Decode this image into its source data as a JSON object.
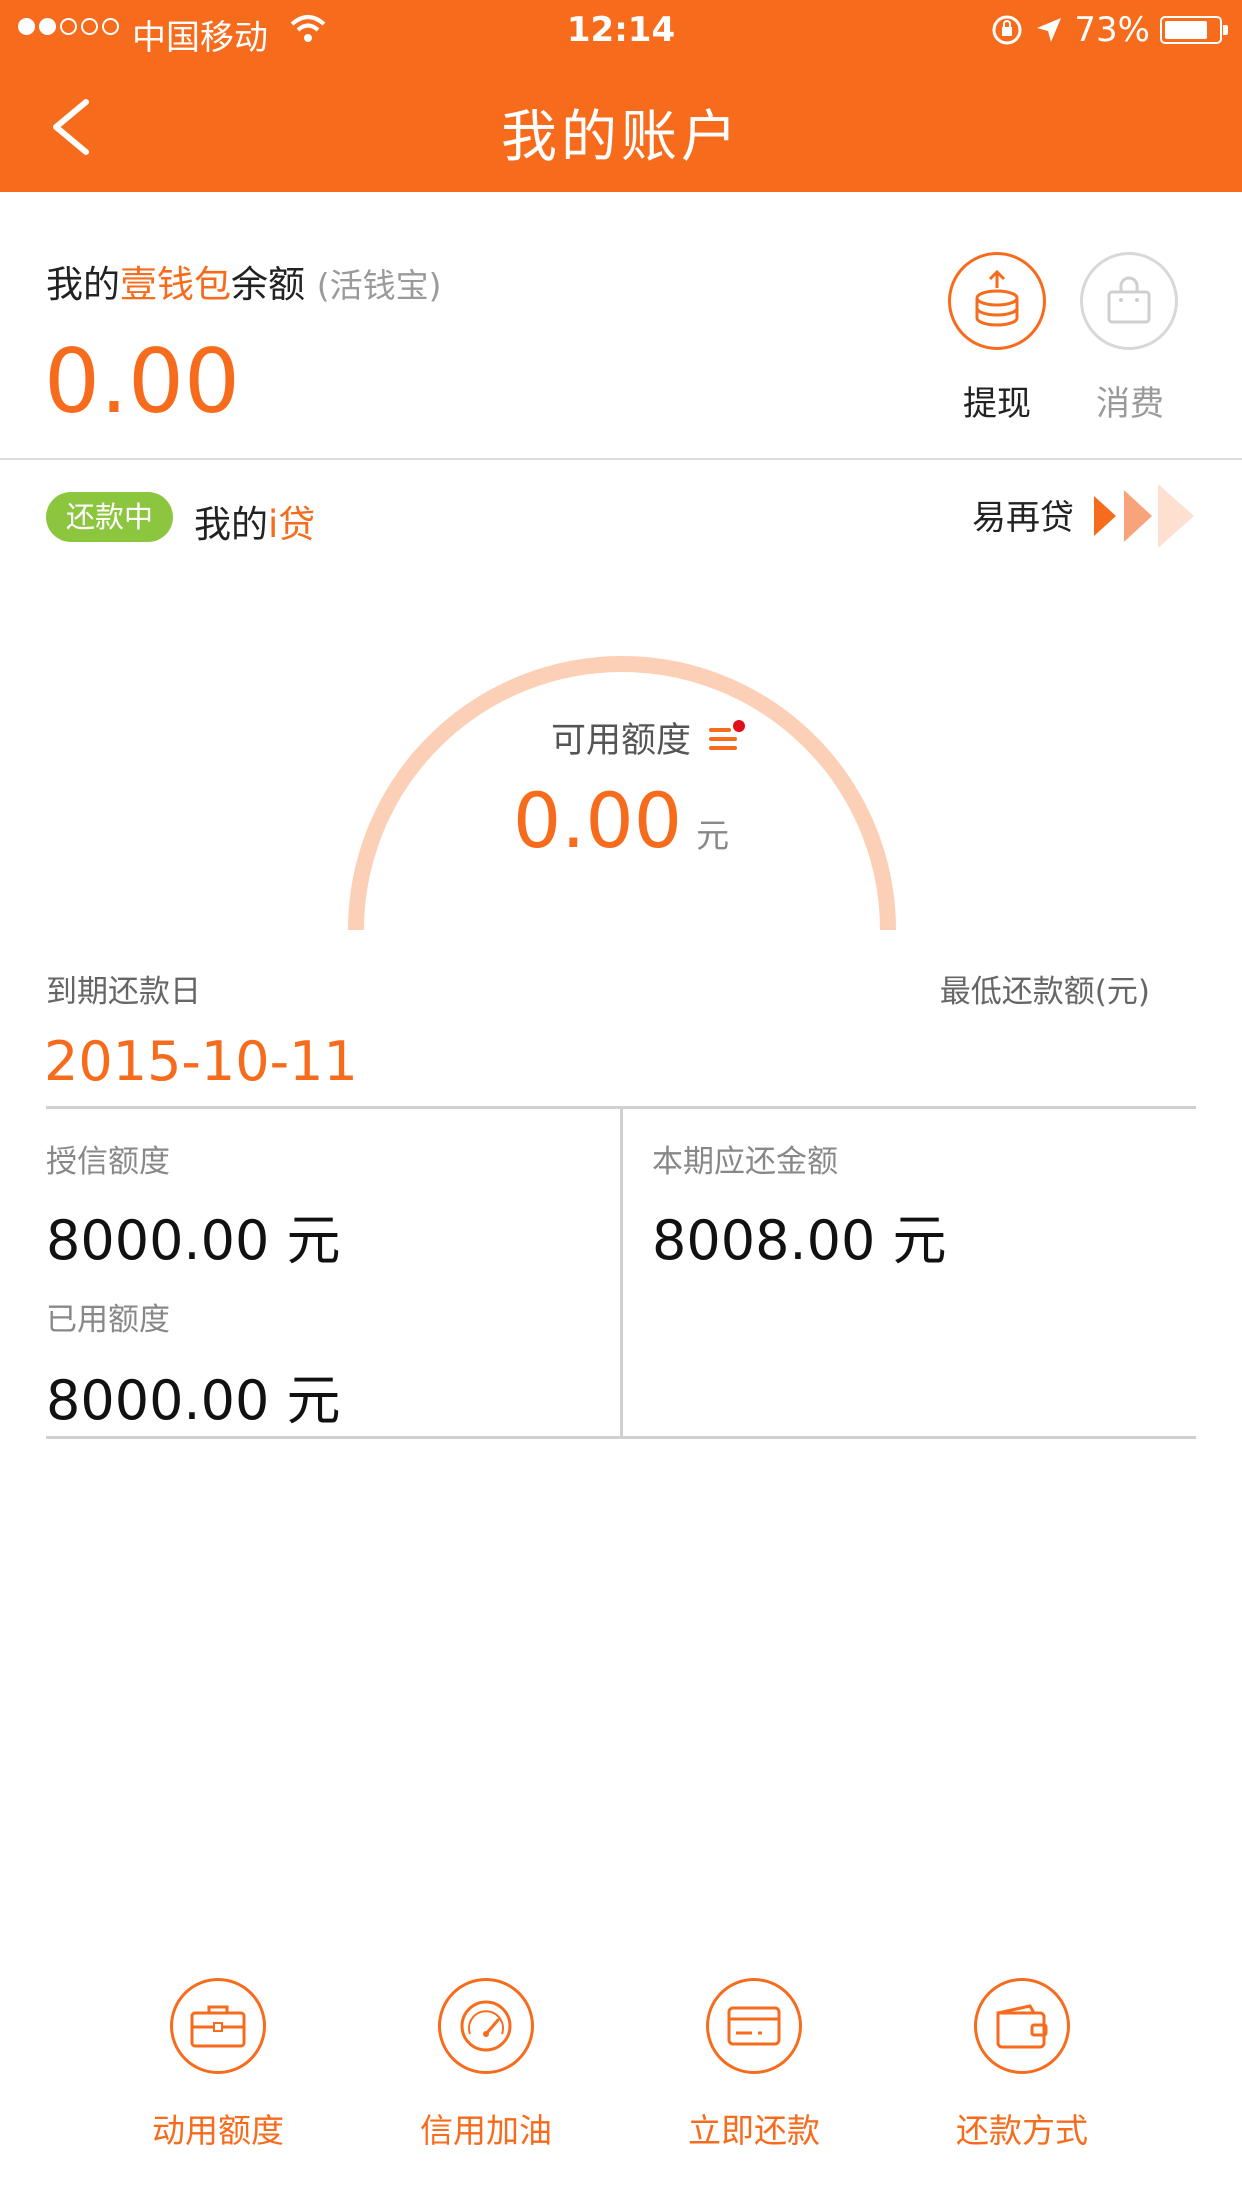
{
  "status_bar": {
    "carrier": "中国移动",
    "time": "12:14",
    "battery": "73%",
    "battery_level": 0.73
  },
  "header": {
    "title": "我的账户"
  },
  "wallet": {
    "label_prefix": "我的",
    "label_brand": "壹钱包",
    "label_suffix": "余额",
    "label_sub": "(活钱宝)",
    "balance": "0.00",
    "withdraw_label": "提现",
    "consume_label": "消费"
  },
  "loan": {
    "badge": "还款中",
    "title_prefix": "我的",
    "title_brand": "i贷",
    "reloan_label": "易再贷",
    "available_label": "可用额度",
    "available_amount": "0.00",
    "available_unit": "元",
    "due_label": "到期还款日",
    "min_label": "最低还款额(元)",
    "due_date": "2015-10-11",
    "credit_label": "授信额度",
    "credit_value": "8000.00 元",
    "used_label": "已用额度",
    "used_value": "8000.00 元",
    "period_label": "本期应还金额",
    "period_value": "8008.00 元"
  },
  "actions": [
    {
      "label": "动用额度",
      "icon": "briefcase-icon"
    },
    {
      "label": "信用加油",
      "icon": "gauge-icon"
    },
    {
      "label": "立即还款",
      "icon": "card-icon"
    },
    {
      "label": "还款方式",
      "icon": "wallet-icon"
    }
  ],
  "colors": {
    "accent": "#f76b1c",
    "badge_green": "#8cc63f",
    "gauge_arc": "#fcd0b6"
  }
}
